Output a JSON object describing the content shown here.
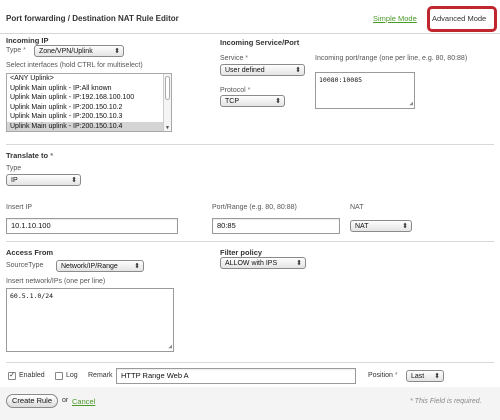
{
  "header": {
    "title": "Port forwarding / Destination NAT Rule Editor",
    "simple_mode": "Simple Mode",
    "advanced_mode": "Advanced Mode"
  },
  "incoming_ip": {
    "title": "Incoming IP",
    "type_label": "Type",
    "required_mark": "*",
    "type_value": "Zone/VPN/Uplink",
    "interfaces_label": "Select interfaces (hold CTRL for multiselect)",
    "interfaces": [
      {
        "label": "<ANY Uplink>",
        "selected": false
      },
      {
        "label": "Uplink Main uplink - IP:All known",
        "selected": false
      },
      {
        "label": "Uplink Main uplink - IP:192.168.100.100",
        "selected": false
      },
      {
        "label": "Uplink Main uplink - IP:200.150.10.2",
        "selected": false
      },
      {
        "label": "Uplink Main uplink - IP:200.150.10.3",
        "selected": false
      },
      {
        "label": "Uplink Main uplink - IP:200.150.10.4",
        "selected": true
      }
    ]
  },
  "incoming_service": {
    "title": "Incoming Service/Port",
    "service_label": "Service",
    "service_value": "User defined",
    "protocol_label": "Protocol",
    "protocol_value": "TCP",
    "port_label": "Incoming port/range (one per line, e.g. 80, 80:88)",
    "port_value": "10080:10085"
  },
  "translate": {
    "title": "Translate to",
    "type_label": "Type",
    "type_value": "IP",
    "insert_ip_label": "Insert IP",
    "insert_ip_value": "10.1.10.100",
    "port_label": "Port/Range (e.g. 80, 80:88)",
    "port_value": "80:85",
    "nat_label": "NAT",
    "nat_value": "NAT"
  },
  "access": {
    "title": "Access From",
    "source_type_label": "SourceType",
    "source_type_value": "Network/IP/Range",
    "networks_label": "Insert network/IPs (one per line)",
    "networks_value": "60.5.1.0/24"
  },
  "filter": {
    "title": "Filter policy",
    "value": "ALLOW with IPS"
  },
  "options": {
    "enabled_label": "Enabled",
    "enabled_checked": true,
    "log_label": "Log",
    "log_checked": false,
    "remark_label": "Remark",
    "remark_value": "HTTP Range Web A",
    "position_label": "Position",
    "position_value": "Last"
  },
  "footer": {
    "create_rule": "Create Rule",
    "or_text": "or",
    "cancel": "Cancel",
    "required_note": "* This Field is required."
  },
  "glyphs": {
    "select_arrow": "⬍",
    "check": "✓",
    "resize": "◢",
    "scroll_down": "▼"
  }
}
